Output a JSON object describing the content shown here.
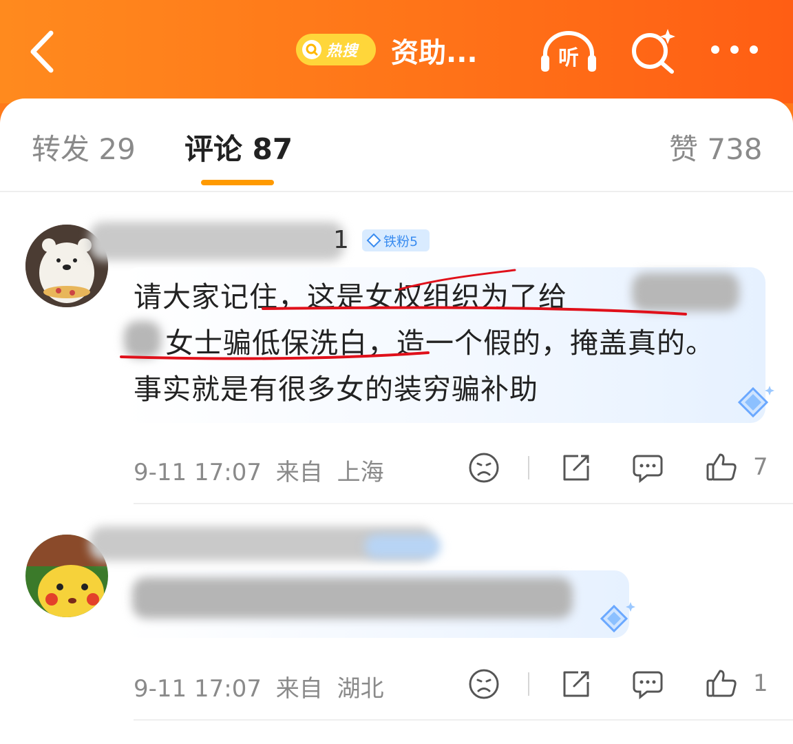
{
  "header": {
    "hot_search_label": "热搜",
    "title": "资助...",
    "listen_label": "听"
  },
  "tabs": {
    "repost": "转发 29",
    "comments": "评论 87",
    "likes": "赞 738"
  },
  "comments": [
    {
      "username_tail": "1",
      "badge": "铁粉5",
      "text_line1": "请大家记住，这是女权组织为了给",
      "text_line2": "女士骗低保洗白，造一个假的，掩盖真的。",
      "text_line3": "事实就是有很多女的装穷骗补助",
      "time": "9-11 17:07",
      "from_label": "来自",
      "location": "上海",
      "like_count": "7"
    },
    {
      "time": "9-11 17:07",
      "from_label": "来自",
      "location": "湖北",
      "like_count": "1"
    }
  ],
  "colors": {
    "header_orange": "#ff7318",
    "tab_underline": "#ff9a00",
    "hot_pill": "#ffd63a",
    "badge_blue": "#3a8cf0",
    "annotation_red": "#e0101a"
  }
}
